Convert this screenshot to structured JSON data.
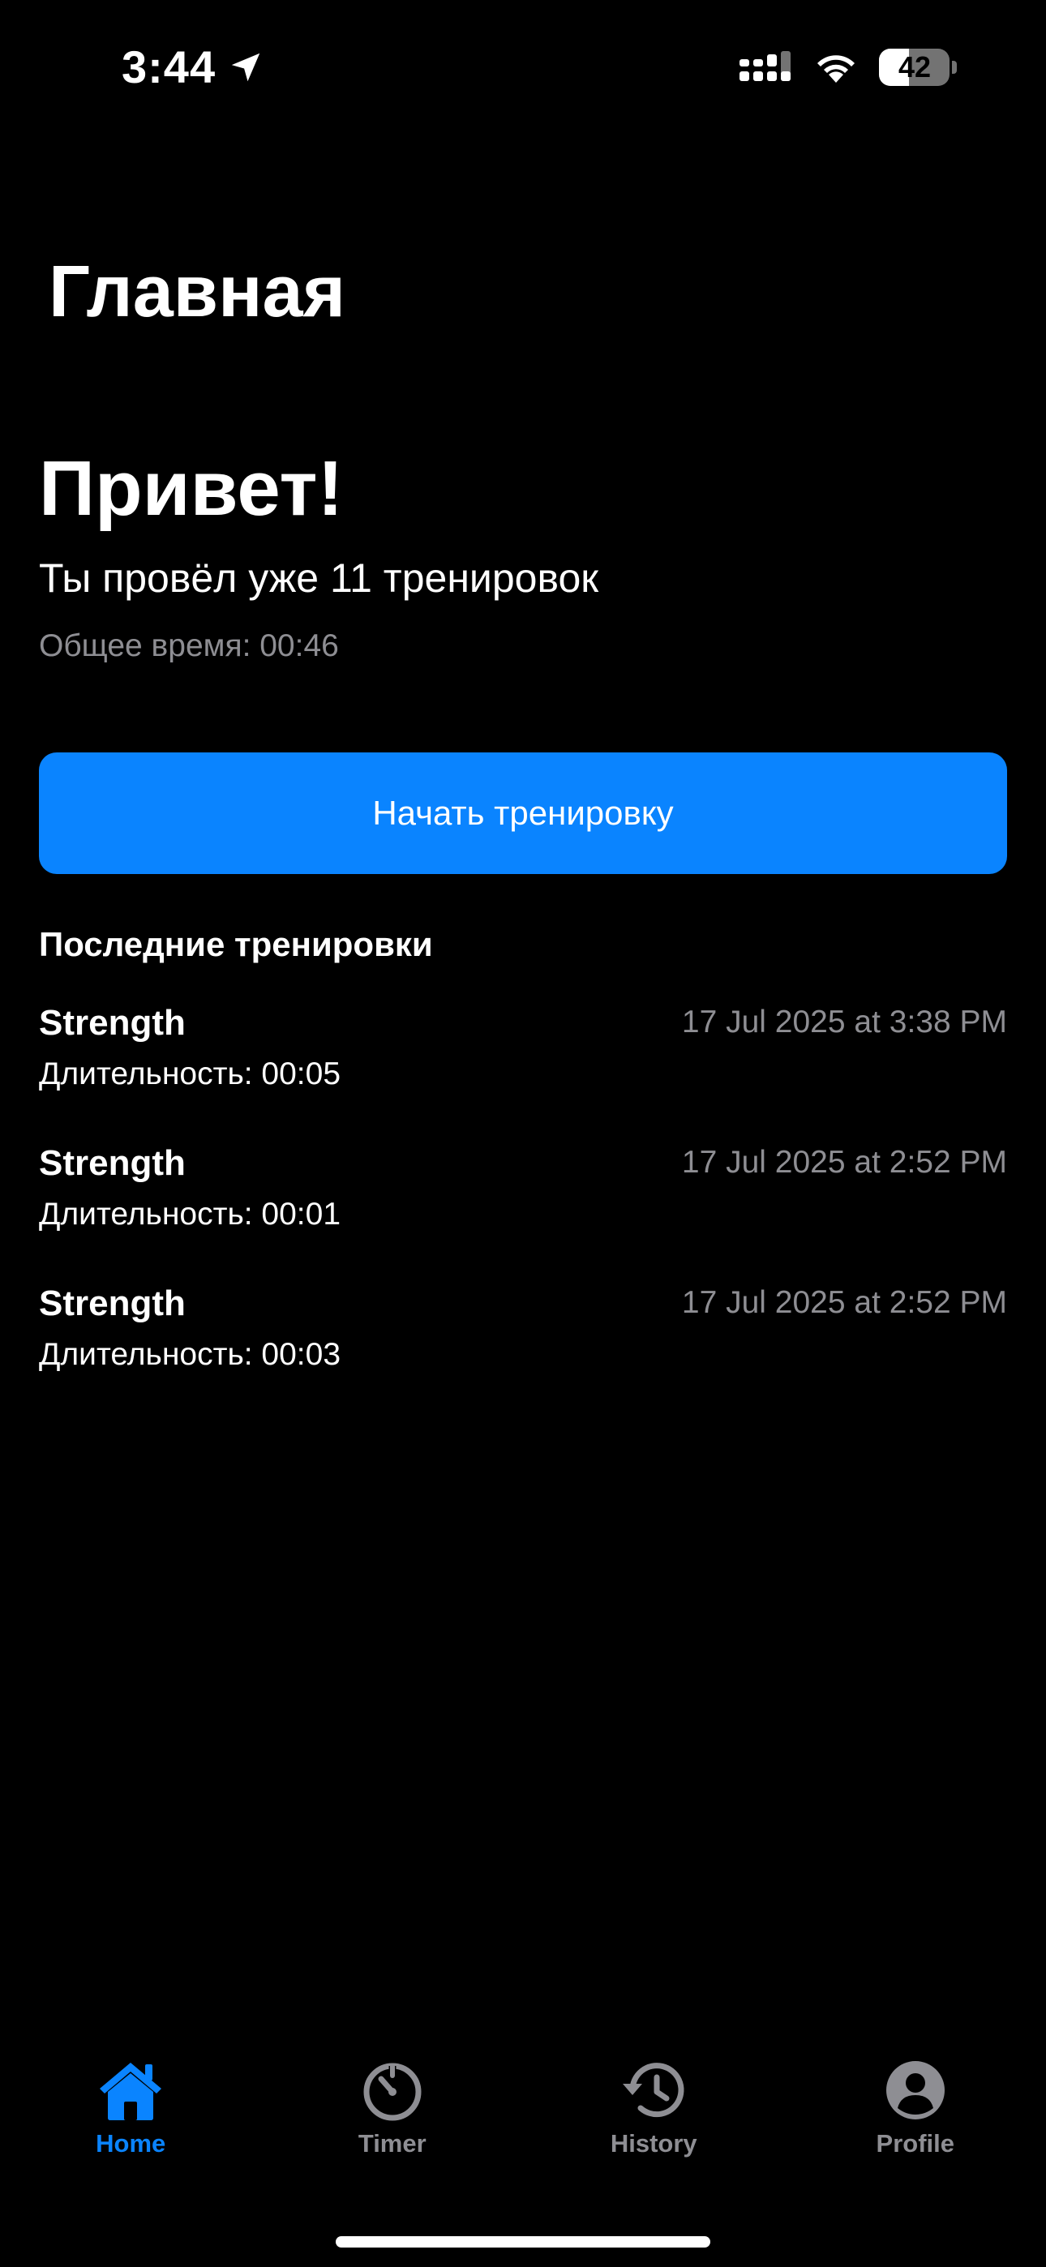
{
  "status_bar": {
    "time": "3:44",
    "battery_level": "42",
    "battery_fraction": 0.42,
    "icons": [
      "location-arrow-icon",
      "cellular-signal-icon",
      "wifi-icon",
      "battery-icon"
    ]
  },
  "header": {
    "title": "Главная"
  },
  "greeting": {
    "title": "Привет!",
    "summary": "Ты провёл уже 11 тренировок",
    "total_time": "Общее время: 00:46"
  },
  "actions": {
    "start_workout_label": "Начать тренировку"
  },
  "recent": {
    "title": "Последние тренировки",
    "items": [
      {
        "type": "Strength",
        "date": "17 Jul 2025 at 3:38 PM",
        "duration": "Длительность: 00:05"
      },
      {
        "type": "Strength",
        "date": "17 Jul 2025 at 2:52 PM",
        "duration": "Длительность: 00:01"
      },
      {
        "type": "Strength",
        "date": "17 Jul 2025 at 2:52 PM",
        "duration": "Длительность: 00:03"
      }
    ]
  },
  "tab_bar": {
    "tabs": [
      {
        "label": "Home",
        "icon": "house-icon",
        "active": true
      },
      {
        "label": "Timer",
        "icon": "timer-icon",
        "active": false
      },
      {
        "label": "History",
        "icon": "history-icon",
        "active": false
      },
      {
        "label": "Profile",
        "icon": "person-circle-icon",
        "active": false
      }
    ]
  },
  "colors": {
    "background": "#000000",
    "accent": "#0a84ff",
    "secondary_text": "#8e8e93",
    "primary_text": "#ffffff"
  }
}
